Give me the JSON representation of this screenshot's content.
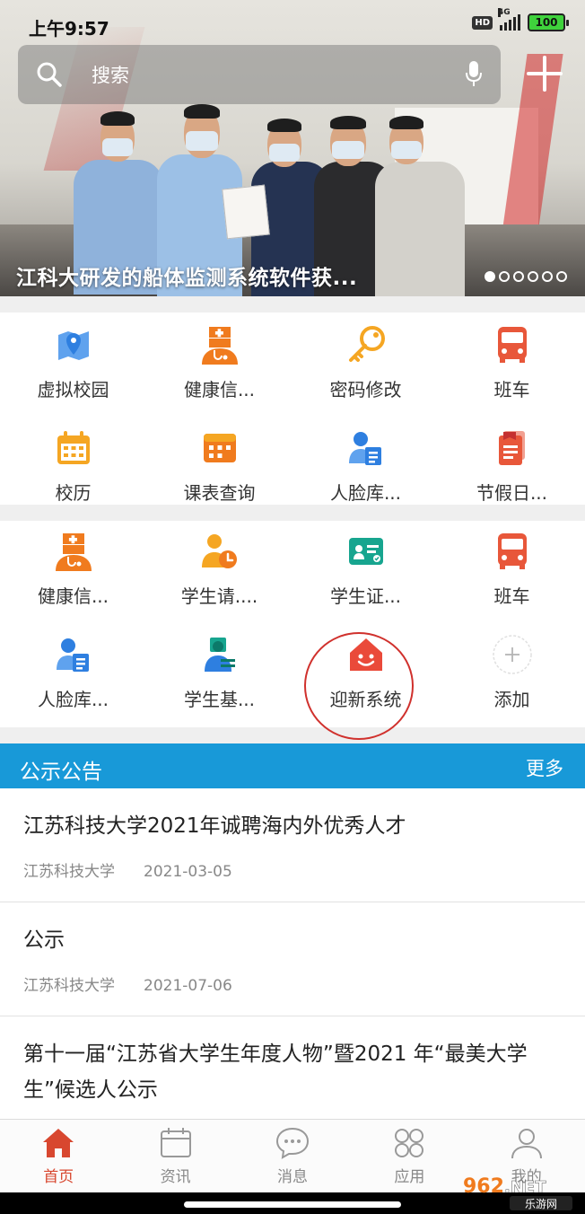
{
  "status_bar": {
    "time": "上午9:57",
    "hd": "HD",
    "network": "4G",
    "battery": "100"
  },
  "search": {
    "placeholder": "搜索"
  },
  "banner": {
    "caption": "江科大研发的船体监测系统软件获...",
    "dots_total": 6,
    "dots_active_index": 0
  },
  "grid_top": [
    {
      "label": "虚拟校园",
      "icon": "map-pin-icon"
    },
    {
      "label": "健康信...",
      "icon": "doctor-icon"
    },
    {
      "label": "密码修改",
      "icon": "key-icon"
    },
    {
      "label": "班车",
      "icon": "bus-icon"
    },
    {
      "label": "校历",
      "icon": "calendar-icon"
    },
    {
      "label": "课表查询",
      "icon": "timetable-icon"
    },
    {
      "label": "人脸库...",
      "icon": "face-library-icon"
    },
    {
      "label": "节假日...",
      "icon": "holiday-icon"
    }
  ],
  "grid_bottom": [
    {
      "label": "健康信...",
      "icon": "doctor-icon"
    },
    {
      "label": "学生请....",
      "icon": "student-leave-icon"
    },
    {
      "label": "学生证...",
      "icon": "student-card-icon"
    },
    {
      "label": "班车",
      "icon": "bus-icon"
    },
    {
      "label": "人脸库...",
      "icon": "face-library-icon"
    },
    {
      "label": "学生基...",
      "icon": "student-info-icon"
    },
    {
      "label": "迎新系统",
      "icon": "welcome-home-icon"
    },
    {
      "label": "添加",
      "icon": "add-icon"
    }
  ],
  "notices": {
    "title": "公示公告",
    "more": "更多",
    "items": [
      {
        "title": "江苏科技大学2021年诚聘海内外优秀人才",
        "source": "江苏科技大学",
        "date": "2021-03-05"
      },
      {
        "title": "公示",
        "source": "江苏科技大学",
        "date": "2021-07-06"
      },
      {
        "title": "第十一届“江苏省大学生年度人物”暨2021 年“最美大学生”候选人公示",
        "source": "",
        "date": ""
      }
    ]
  },
  "tabs": [
    {
      "label": "首页",
      "icon": "home-icon",
      "active": true
    },
    {
      "label": "资讯",
      "icon": "news-icon",
      "active": false
    },
    {
      "label": "消息",
      "icon": "message-icon",
      "active": false
    },
    {
      "label": "应用",
      "icon": "apps-icon",
      "active": false
    },
    {
      "label": "我的",
      "icon": "profile-icon",
      "active": false
    }
  ],
  "colors": {
    "accent_blue": "#1899d8",
    "accent_orange": "#f07b1e",
    "active_tab": "#d8472f",
    "icon_blue": "#3a8ee6",
    "icon_teal": "#17a58f"
  },
  "watermark": {
    "text": "962.NET",
    "subtext": "乐游网"
  }
}
